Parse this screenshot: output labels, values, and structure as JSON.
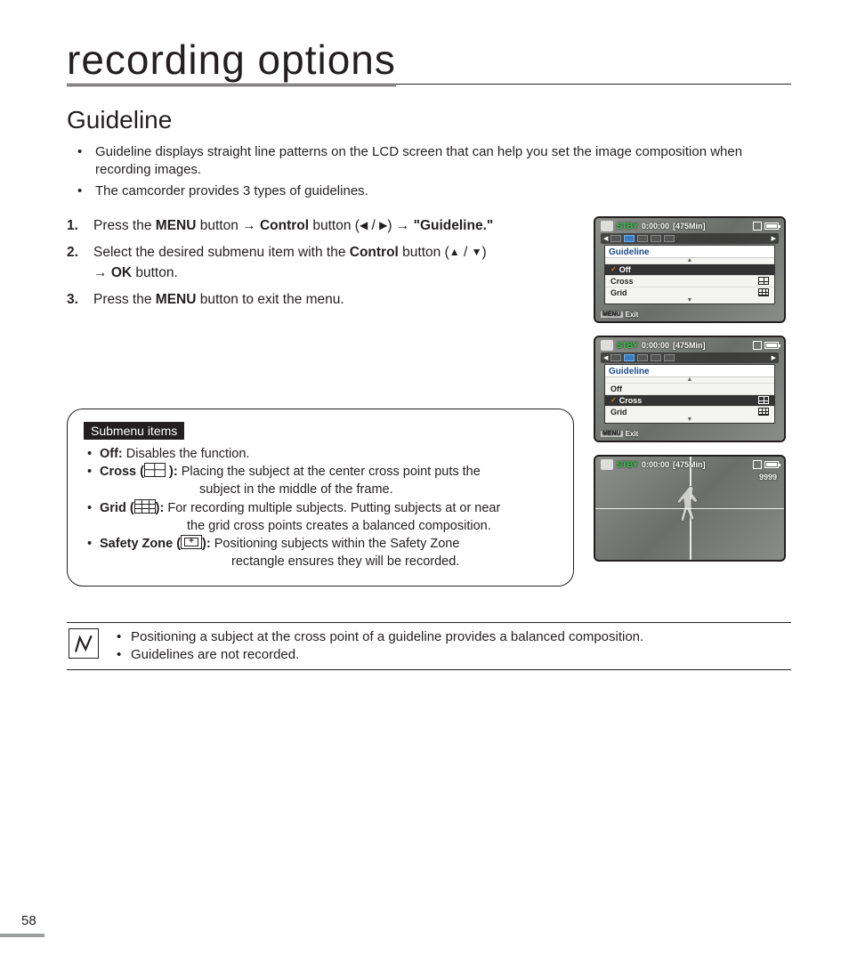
{
  "page_title": "recording options",
  "section_heading": "Guideline",
  "intro_bullets": [
    "Guideline displays straight line patterns on the LCD screen that can help you set the image composition when recording images.",
    "The camcorder provides 3 types of guidelines."
  ],
  "steps": {
    "s1_num": "1.",
    "s1_a": "Press the ",
    "s1_menu": "MENU",
    "s1_b": " button ",
    "s1_arrow1": "→",
    "s1_control": "Control",
    "s1_c": " button (",
    "s1_left": "◀",
    "s1_slash": " / ",
    "s1_right": "▶",
    "s1_d": ") ",
    "s1_arrow2": "→",
    "s1_e": " \"Guideline.\"",
    "s2_num": "2.",
    "s2_a": "Select the desired submenu item with the ",
    "s2_control": "Control",
    "s2_b": " button (",
    "s2_up": "▲",
    "s2_slash": " / ",
    "s2_down": "▼",
    "s2_c": ") ",
    "s2_arrow": "→",
    "s2_ok": "OK",
    "s2_d": " button.",
    "s3_num": "3.",
    "s3_a": "Press the ",
    "s3_menu": "MENU",
    "s3_b": " button to exit the menu."
  },
  "submenu": {
    "title": "Submenu items",
    "off_label": "Off:",
    "off_text": " Disables the function.",
    "cross_label_a": "Cross (",
    "cross_label_b": "):",
    "cross_text_1": " Placing the subject at the center cross point puts the",
    "cross_text_2": "subject in the middle of the frame.",
    "grid_label_a": "Grid (",
    "grid_label_b": "):",
    "grid_text_1": " For recording multiple subjects. Putting subjects at or near",
    "grid_text_2": "the grid cross points creates a balanced composition.",
    "safety_label_a": "Safety Zone (",
    "safety_label_b": "):",
    "safety_text_1": " Positioning subjects within the Safety Zone",
    "safety_text_2": "rectangle ensures they will be recorded."
  },
  "notes": [
    "Positioning a subject at the cross point of a guideline provides a balanced composition.",
    "Guidelines are not recorded."
  ],
  "page_number": "58",
  "lcd": {
    "stby": "STBY",
    "time": "0:00:00",
    "remain": "[475Min]",
    "menu_label": "MENU",
    "exit": "Exit",
    "guideline": "Guideline",
    "off": "Off",
    "cross": "Cross",
    "grid": "Grid",
    "count": "9999"
  }
}
